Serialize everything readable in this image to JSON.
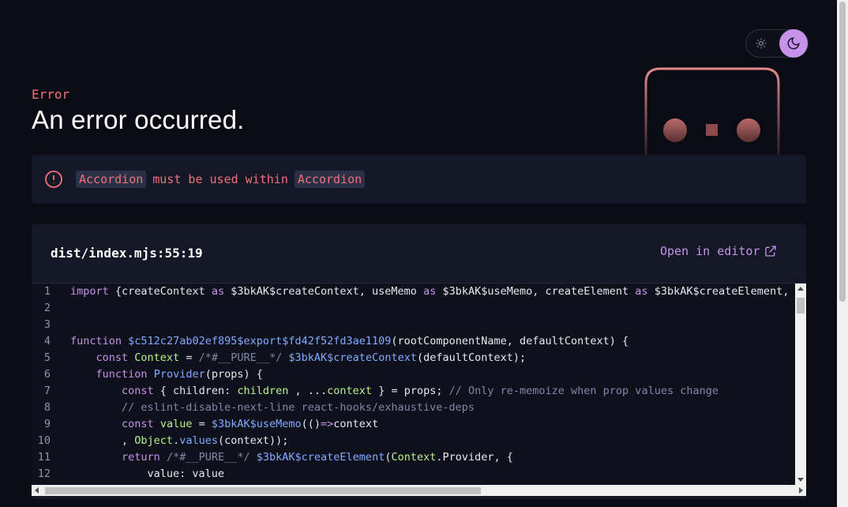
{
  "theme_toggle": {
    "light_icon": "sun-icon",
    "dark_icon": "moon-icon",
    "active": "dark"
  },
  "error": {
    "label": "Error",
    "title": "An error occurred.",
    "message": {
      "component": "Accordion",
      "middle": "must be used within",
      "parent": "Accordion"
    }
  },
  "code_panel": {
    "file_location": "dist/index.mjs:55:19",
    "open_in_editor_label": "Open in editor",
    "lines": [
      {
        "n": "1"
      },
      {
        "n": "2"
      },
      {
        "n": "3"
      },
      {
        "n": "4"
      },
      {
        "n": "5"
      },
      {
        "n": "6"
      },
      {
        "n": "7"
      },
      {
        "n": "8"
      },
      {
        "n": "9"
      },
      {
        "n": "10"
      },
      {
        "n": "11"
      },
      {
        "n": "12"
      }
    ],
    "tokens": {
      "l1": [
        "import",
        " {createContext ",
        "as",
        " $3bkAK$createContext, useMemo ",
        "as",
        " $3bkAK$useMemo, createElement ",
        "as",
        " $3bkAK$createElement,"
      ],
      "l4": [
        "function",
        " ",
        "$c512c27ab02ef895$export$fd42f52fd3ae1109",
        "(rootComponentName, defaultContext) {"
      ],
      "l5": [
        "    ",
        "const",
        " ",
        "Context",
        " = ",
        "/*#__PURE__*/",
        " ",
        "$3bkAK$createContext",
        "(defaultContext);"
      ],
      "l6": [
        "    ",
        "function",
        " ",
        "Provider",
        "(props) {"
      ],
      "l7": [
        "        ",
        "const",
        " { children: ",
        "children",
        " , ...",
        "context",
        " } = props; ",
        "// Only re-memoize when prop values change"
      ],
      "l8": [
        "        ",
        "// eslint-disable-next-line react-hooks/exhaustive-deps"
      ],
      "l9": [
        "        ",
        "const",
        " ",
        "value",
        " = ",
        "$3bkAK$useMemo",
        "(()",
        "=>",
        "context"
      ],
      "l10": [
        "        , ",
        "Object",
        ".",
        "values",
        "(context));"
      ],
      "l11": [
        "        ",
        "return",
        " ",
        "/*#__PURE__*/",
        " ",
        "$3bkAK$createElement",
        "(",
        "Context",
        ".Provider, {"
      ],
      "l12": [
        "            value: value"
      ]
    }
  },
  "colors": {
    "background": "#0a0b14",
    "panel": "#141826",
    "error_red": "#f07178",
    "accent_purple": "#c792ea",
    "function_blue": "#82aaff",
    "variable_green": "#b9f18d",
    "comment_gray": "#7e87a6"
  }
}
